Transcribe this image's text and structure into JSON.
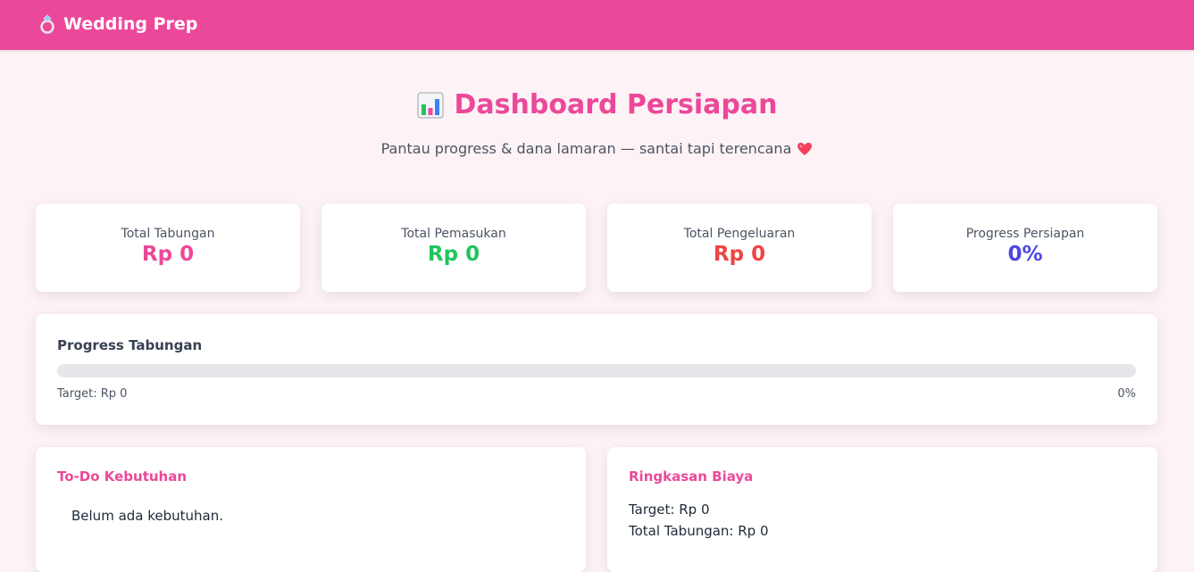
{
  "app": {
    "brand_icon": "ring-icon",
    "brand_name": "Wedding Prep"
  },
  "hero": {
    "icon": "bar-chart-icon",
    "title": "Dashboard Persiapan",
    "subtitle": "Pantau progress & dana lamaran — santai tapi terencana",
    "subtitle_icon": "heart-icon"
  },
  "stats": [
    {
      "label": "Total Tabungan",
      "value": "Rp 0",
      "color": "#ec4899"
    },
    {
      "label": "Total Pemasukan",
      "value": "Rp 0",
      "color": "#22c55e"
    },
    {
      "label": "Total Pengeluaran",
      "value": "Rp 0",
      "color": "#ef4444"
    },
    {
      "label": "Progress Persiapan",
      "value": "0%",
      "color": "#4f46e5"
    }
  ],
  "savings_progress": {
    "title": "Progress Tabungan",
    "target_text": "Target: Rp 0",
    "percent_text": "0%",
    "fraction": 0
  },
  "todo": {
    "title": "To-Do Kebutuhan",
    "empty_text": "Belum ada kebutuhan."
  },
  "summary": {
    "title": "Ringkasan Biaya",
    "lines": [
      "Target: Rp 0",
      "Total Tabungan: Rp 0"
    ]
  },
  "colors": {
    "primary": "#ec4899",
    "income": "#22c55e",
    "expense": "#ef4444",
    "progress": "#4f46e5",
    "background": "#fdf2f6"
  }
}
